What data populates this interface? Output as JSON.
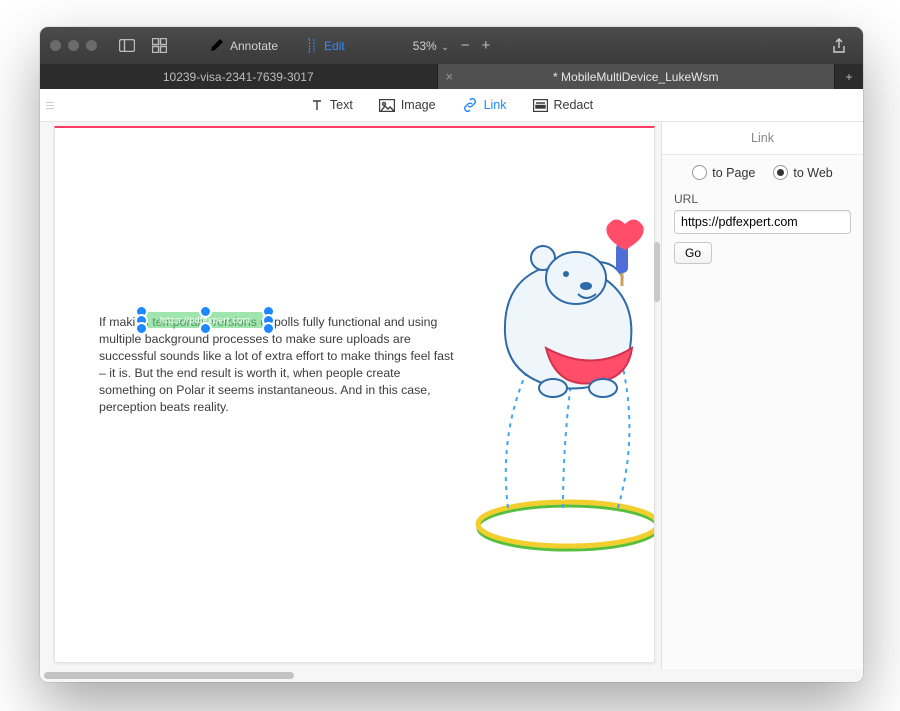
{
  "toolbar": {
    "annotate_label": "Annotate",
    "edit_label": "Edit",
    "zoom_value": "53%"
  },
  "tabs": [
    {
      "title": "10239-visa-2341-7639-3017",
      "active": false
    },
    {
      "title": "* MobileMultiDevice_LukeWsm",
      "active": true
    }
  ],
  "edit_tools": {
    "text": "Text",
    "image": "Image",
    "link": "Link",
    "redact": "Redact"
  },
  "document": {
    "highlight_text": "https://pdfexpert.com",
    "paragraph": "If making temporary versions of polls fully functional and using multiple background processes to make sure uploads are successful sounds like a lot of extra effort to make things feel fast – it is. But the end result is worth it, when people create something on Polar it seems instantaneous. And in this case, perception beats reality."
  },
  "inspector": {
    "title": "Link",
    "to_page": "to Page",
    "to_web": "to Web",
    "url_label": "URL",
    "url_value": "https://pdfexpert.com",
    "go_label": "Go"
  }
}
